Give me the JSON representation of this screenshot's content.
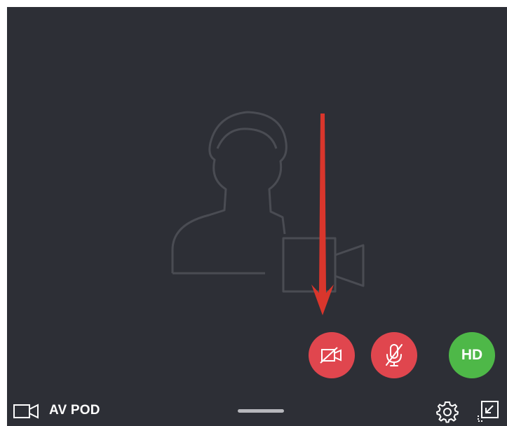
{
  "window": {
    "title": "AV POD"
  },
  "controls": {
    "hd_label": "HD"
  },
  "icons": {
    "pod": "video-camera-icon",
    "placeholder": "user-with-camera-placeholder-icon",
    "camera_button": "video-camera-off-icon",
    "mic_button": "microphone-off-icon",
    "settings": "gear-icon",
    "minimize": "minimize-window-icon"
  },
  "colors": {
    "background": "#2d2f36",
    "muted_button": "#e0464e",
    "hd_button": "#4eb848",
    "annotation_arrow": "#d9362c",
    "placeholder_outline": "#4a4c53"
  }
}
